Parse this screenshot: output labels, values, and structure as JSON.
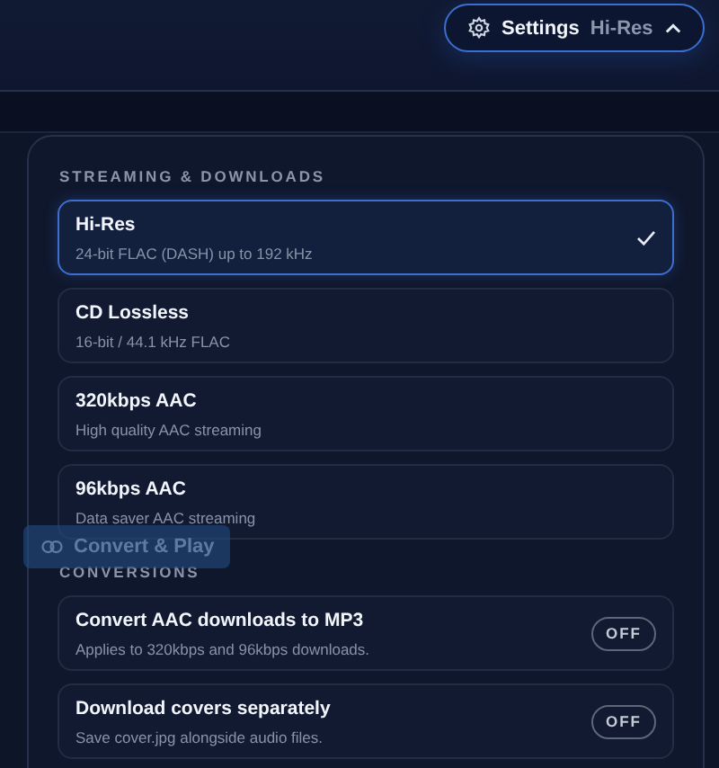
{
  "header": {
    "settings_button": {
      "label": "Settings",
      "value": "Hi-Res",
      "expanded": true
    }
  },
  "background_button": {
    "label": "Convert & Play"
  },
  "settings_panel": {
    "sections": [
      {
        "title": "STREAMING & DOWNLOADS",
        "kind": "choices",
        "items": [
          {
            "title": "Hi-Res",
            "description": "24-bit FLAC (DASH) up to 192 kHz",
            "selected": true
          },
          {
            "title": "CD Lossless",
            "description": "16-bit / 44.1 kHz FLAC",
            "selected": false
          },
          {
            "title": "320kbps AAC",
            "description": "High quality AAC streaming",
            "selected": false
          },
          {
            "title": "96kbps AAC",
            "description": "Data saver AAC streaming",
            "selected": false
          }
        ]
      },
      {
        "title": "CONVERSIONS",
        "kind": "toggles",
        "items": [
          {
            "title": "Convert AAC downloads to MP3",
            "description": "Applies to 320kbps and 96kbps downloads.",
            "on": false,
            "toggle_label": "OFF"
          },
          {
            "title": "Download covers separately",
            "description": "Save cover.jpg alongside audio files.",
            "on": false,
            "toggle_label": "OFF"
          }
        ]
      }
    ]
  }
}
